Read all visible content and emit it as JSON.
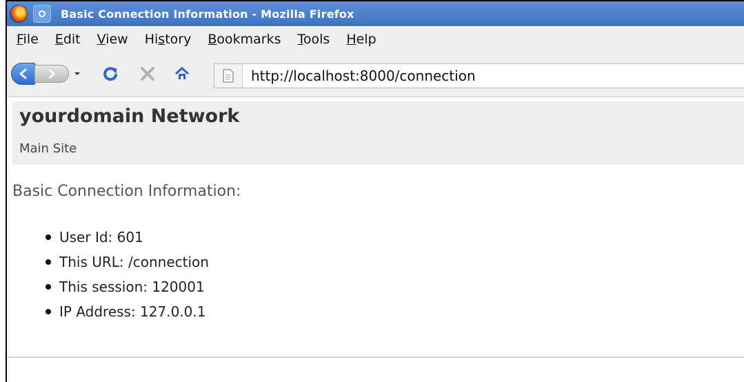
{
  "window": {
    "title": "Basic Connection Information - Mozilla Firefox"
  },
  "menubar": {
    "items": [
      {
        "key": "F",
        "rest": "ile"
      },
      {
        "key": "E",
        "rest": "dit"
      },
      {
        "key": "V",
        "rest": "iew"
      },
      {
        "pre": "Hi",
        "key": "s",
        "rest": "tory"
      },
      {
        "key": "B",
        "rest": "ookmarks"
      },
      {
        "key": "T",
        "rest": "ools"
      },
      {
        "key": "H",
        "rest": "elp"
      }
    ]
  },
  "navbar": {
    "url": "http://localhost:8000/connection"
  },
  "icons": {
    "logo": "firefox-logo-icon",
    "window_menu": "window-menu-icon",
    "back": "back-arrow-icon",
    "forward": "forward-arrow-icon",
    "history": "chevron-down-icon",
    "reload": "reload-icon",
    "stop": "stop-icon",
    "home": "home-icon",
    "site": "page-icon"
  },
  "page": {
    "site_title": "yourdomain Network",
    "site_subtitle": "Main Site",
    "section_heading": "Basic Connection Information:",
    "info_items": [
      "User Id: 601",
      "This URL: /connection",
      "This session: 120001",
      "IP Address: 127.0.0.1"
    ]
  },
  "colors": {
    "titlebar": "#3d73c2",
    "accent_blue": "#2d67c9",
    "header_bg": "#eeeeee"
  }
}
